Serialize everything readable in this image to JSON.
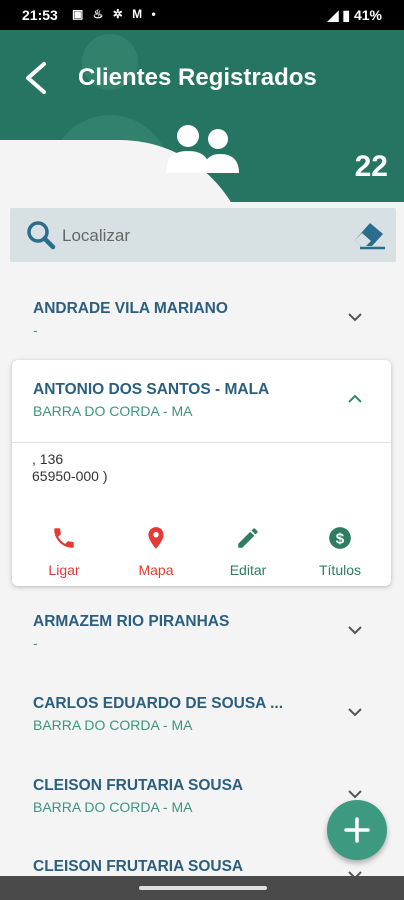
{
  "status_bar": {
    "time": "21:53",
    "notifications": "▣ ♨ ✲ M •",
    "signal_battery": "◢ ▮ 41%"
  },
  "header": {
    "title": "Clientes Registrados",
    "count": "22"
  },
  "search": {
    "placeholder": "Localizar"
  },
  "clients": [
    {
      "name": "ANDRADE VILA MARIANO",
      "city": "-"
    },
    {
      "name": "ANTONIO DOS SANTOS - MALA",
      "city": "BARRA DO CORDA - MA"
    },
    {
      "name": "ARMAZEM RIO PIRANHAS",
      "city": "-"
    },
    {
      "name": "CARLOS EDUARDO DE SOUSA ...",
      "city": "BARRA DO CORDA - MA"
    },
    {
      "name": "CLEISON FRUTARIA SOUSA",
      "city": "BARRA DO CORDA - MA"
    },
    {
      "name": "CLEISON FRUTARIA SOUSA",
      "city": ""
    }
  ],
  "expanded": {
    "address_line1": ", 136",
    "address_line2": "65950-000 )",
    "actions": {
      "ligar": "Ligar",
      "mapa": "Mapa",
      "editar": "Editar",
      "titulos": "Títulos"
    }
  },
  "colors": {
    "header": "#267562",
    "name_text": "#2b5f80",
    "city_text": "#3f9480",
    "action_red": "#e53935",
    "action_green": "#2e7d62",
    "fab": "#3d9a80"
  }
}
